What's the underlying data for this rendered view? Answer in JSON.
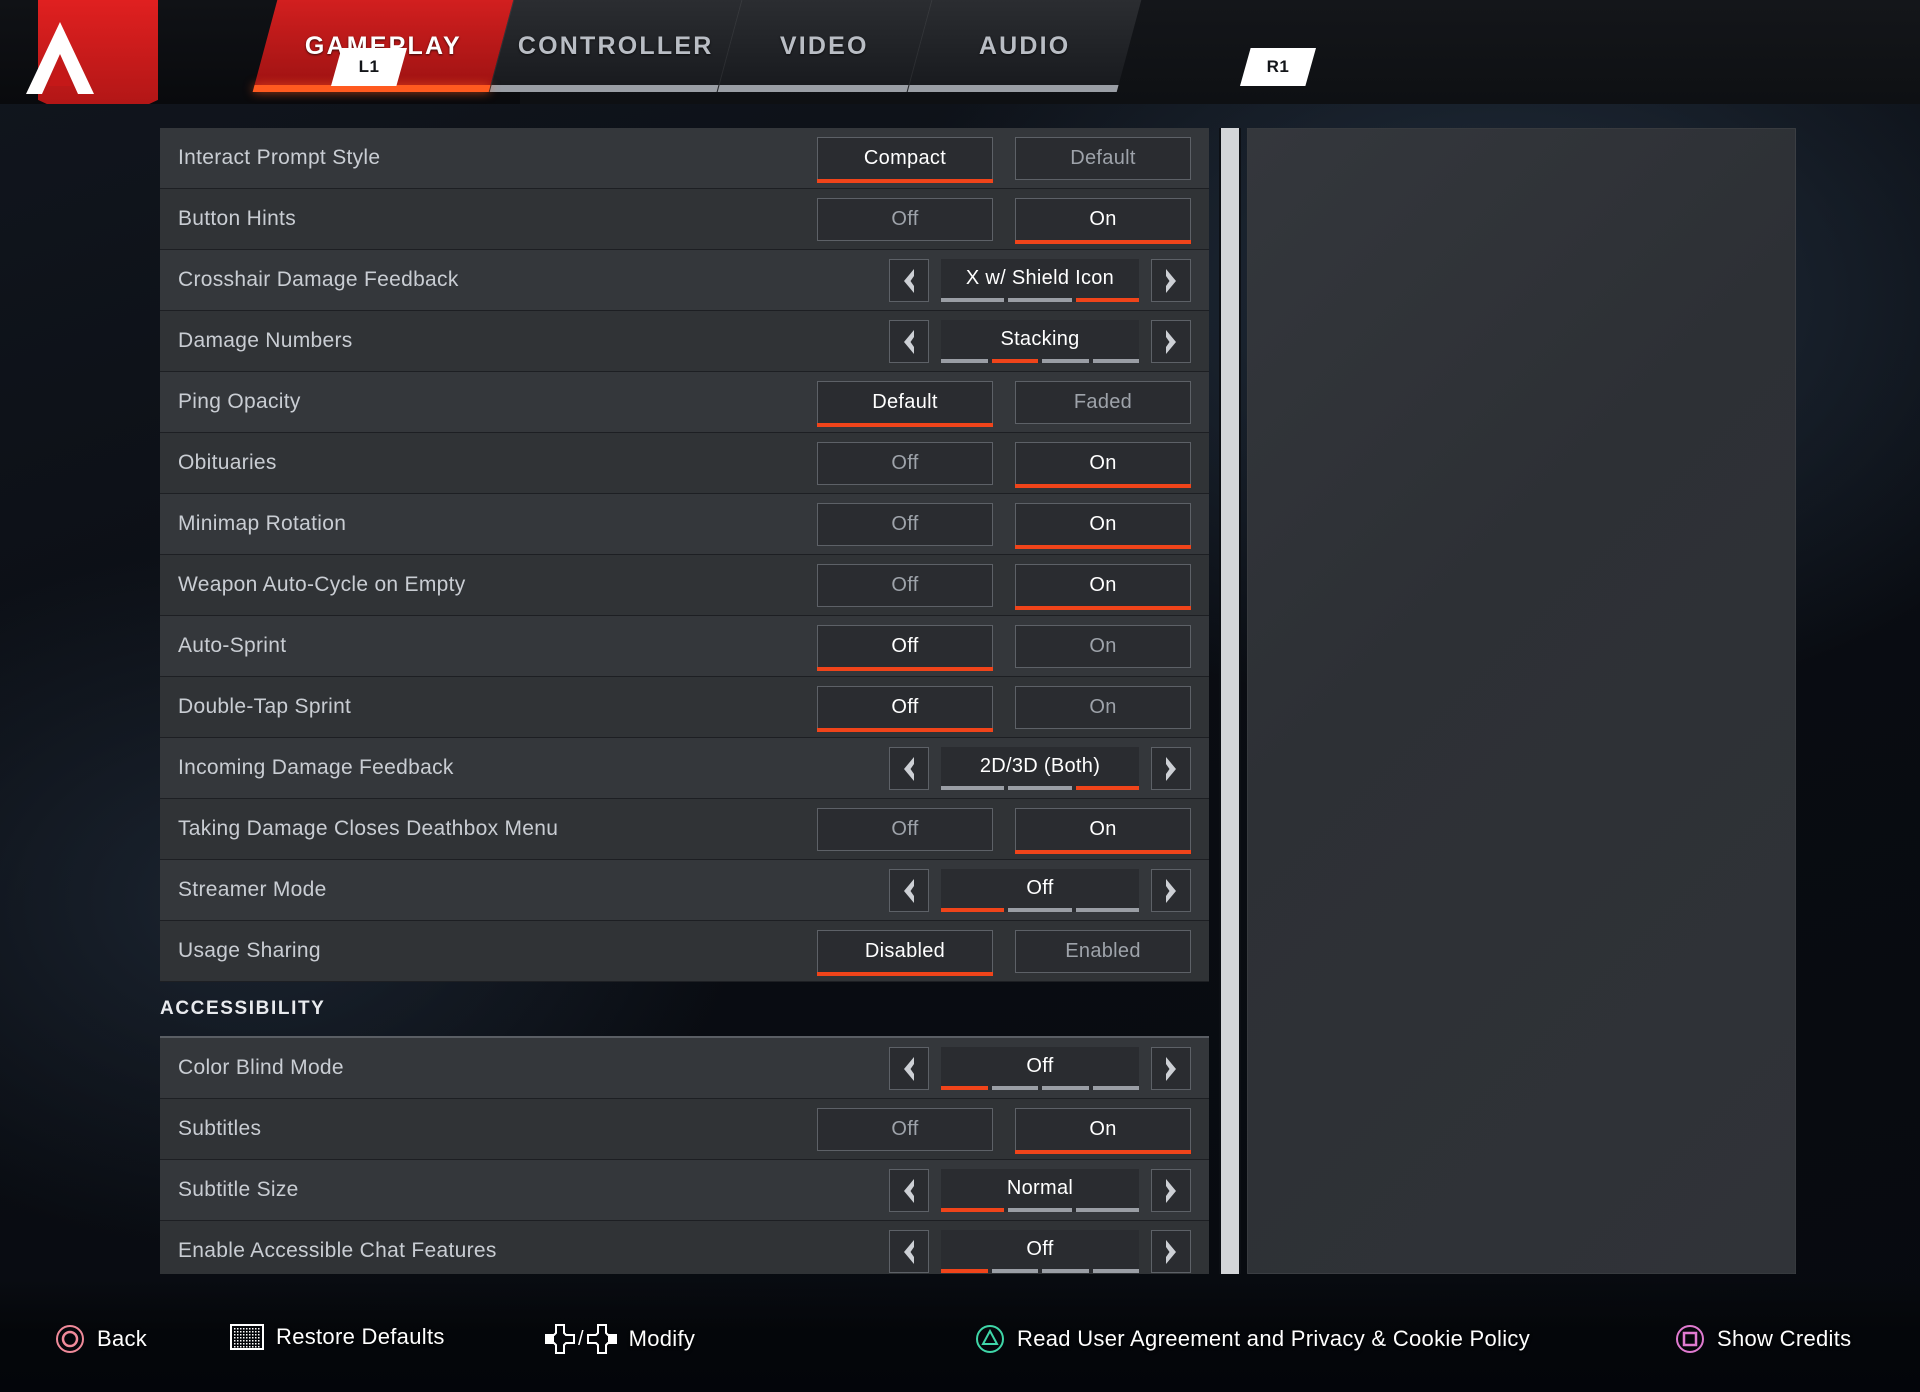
{
  "topbar": {
    "logo_icon": "apex-legends-logo",
    "left_bumper": "L1",
    "right_bumper": "R1",
    "tabs": [
      {
        "label": "GAMEPLAY",
        "active": true
      },
      {
        "label": "CONTROLLER",
        "active": false
      },
      {
        "label": "VIDEO",
        "active": false
      },
      {
        "label": "AUDIO",
        "active": false
      }
    ]
  },
  "settings": {
    "rows": [
      {
        "label": "Interact Prompt Style",
        "type": "toggle",
        "options": [
          "Compact",
          "Default"
        ],
        "selected": 0
      },
      {
        "label": "Button Hints",
        "type": "toggle",
        "options": [
          "Off",
          "On"
        ],
        "selected": 1
      },
      {
        "label": "Crosshair Damage Feedback",
        "type": "stepper",
        "value": "X w/ Shield Icon",
        "segments": 3,
        "active_segment": 3
      },
      {
        "label": "Damage Numbers",
        "type": "stepper",
        "value": "Stacking",
        "segments": 4,
        "active_segment": 2
      },
      {
        "label": "Ping Opacity",
        "type": "toggle",
        "options": [
          "Default",
          "Faded"
        ],
        "selected": 0
      },
      {
        "label": "Obituaries",
        "type": "toggle",
        "options": [
          "Off",
          "On"
        ],
        "selected": 1
      },
      {
        "label": "Minimap Rotation",
        "type": "toggle",
        "options": [
          "Off",
          "On"
        ],
        "selected": 1
      },
      {
        "label": "Weapon Auto-Cycle on Empty",
        "type": "toggle",
        "options": [
          "Off",
          "On"
        ],
        "selected": 1
      },
      {
        "label": "Auto-Sprint",
        "type": "toggle",
        "options": [
          "Off",
          "On"
        ],
        "selected": 0
      },
      {
        "label": "Double-Tap Sprint",
        "type": "toggle",
        "options": [
          "Off",
          "On"
        ],
        "selected": 0
      },
      {
        "label": "Incoming Damage Feedback",
        "type": "stepper",
        "value": "2D/3D (Both)",
        "segments": 3,
        "active_segment": 3
      },
      {
        "label": "Taking Damage Closes Deathbox Menu",
        "type": "toggle",
        "options": [
          "Off",
          "On"
        ],
        "selected": 1
      },
      {
        "label": "Streamer Mode",
        "type": "stepper",
        "value": "Off",
        "segments": 3,
        "active_segment": 1
      },
      {
        "label": "Usage Sharing",
        "type": "toggle",
        "options": [
          "Disabled",
          "Enabled"
        ],
        "selected": 0
      }
    ],
    "section_title": "ACCESSIBILITY",
    "accessibility_rows": [
      {
        "label": "Color Blind Mode",
        "type": "stepper",
        "value": "Off",
        "segments": 4,
        "active_segment": 1
      },
      {
        "label": "Subtitles",
        "type": "toggle",
        "options": [
          "Off",
          "On"
        ],
        "selected": 1
      },
      {
        "label": "Subtitle Size",
        "type": "stepper",
        "value": "Normal",
        "segments": 3,
        "active_segment": 1
      },
      {
        "label": "Enable Accessible Chat Features",
        "type": "stepper",
        "value": "Off",
        "segments": 4,
        "active_segment": 1
      }
    ]
  },
  "footer": {
    "items": [
      {
        "icon": "playstation-circle-icon",
        "label": "Back"
      },
      {
        "icon": "touchpad-icon",
        "label": "Restore Defaults"
      },
      {
        "icon": "dpad-left-right-icon",
        "label": "Modify"
      },
      {
        "icon": "playstation-triangle-icon",
        "label": "Read User Agreement and Privacy & Cookie Policy"
      },
      {
        "icon": "playstation-square-icon",
        "label": "Show Credits"
      }
    ]
  },
  "colors": {
    "accent_orange": "#f0441a",
    "brand_red": "#d21f1f",
    "circle_pink": "#f08a9a",
    "triangle_green": "#3fd6a8",
    "square_magenta": "#e07ad0"
  }
}
